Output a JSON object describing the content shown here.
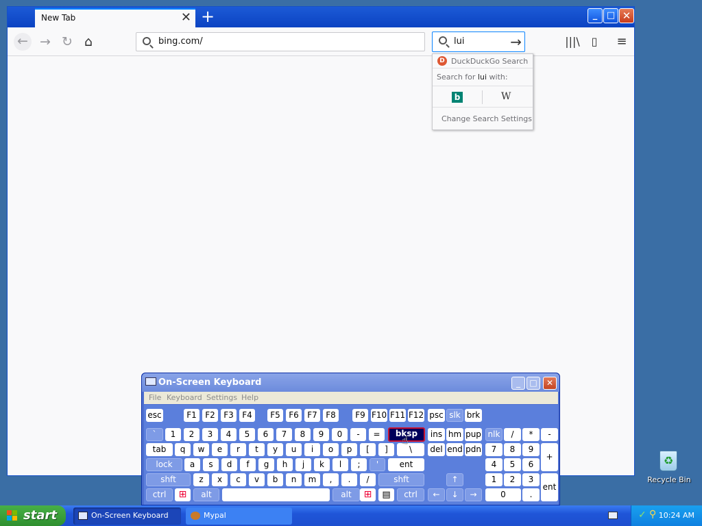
{
  "browser": {
    "tab_title": "New Tab",
    "tab_close": "✕",
    "new_tab": "+",
    "url": "bing.com/",
    "search_query": "lui",
    "search_go": "→",
    "nav": {
      "back": "←",
      "forward": "→",
      "reload": "↻",
      "home": "⌂",
      "library": "|||\\",
      "sidebar": "▯",
      "menu": "≡"
    },
    "window_controls": {
      "minimize": "_",
      "maximize": "□",
      "close": "✕"
    }
  },
  "search_popup": {
    "engine_name": "DuckDuckGo Search",
    "search_for_prefix": "Search for ",
    "search_for_query": "lui",
    "search_for_suffix": " with:",
    "engine_bing": "b",
    "engine_wiki": "W",
    "change_settings": "Change Search Settings"
  },
  "desktop": {
    "recycle_bin": "Recycle Bin"
  },
  "osk": {
    "title": "On-Screen Keyboard",
    "controls": {
      "minimize": "_",
      "maximize": "□",
      "close": "✕"
    },
    "menus": [
      "File",
      "Keyboard",
      "Settings",
      "Help"
    ],
    "keys": {
      "esc": "esc",
      "fn": [
        "F1",
        "F2",
        "F3",
        "F4",
        "F5",
        "F6",
        "F7",
        "F8",
        "F9",
        "F10",
        "F11",
        "F12"
      ],
      "psc": "psc",
      "slk": "slk",
      "brk": "brk",
      "num_row": [
        "`",
        "1",
        "2",
        "3",
        "4",
        "5",
        "6",
        "7",
        "8",
        "9",
        "0",
        "-",
        "="
      ],
      "bksp": "bksp",
      "ins": "ins",
      "hm": "hm",
      "pup": "pup",
      "nlk": "nlk",
      "np_div": "/",
      "np_mul": "*",
      "np_sub": "-",
      "tab": "tab",
      "q_row": [
        "q",
        "w",
        "e",
        "r",
        "t",
        "y",
        "u",
        "i",
        "o",
        "p",
        "[",
        "]",
        "\\"
      ],
      "del": "del",
      "end": "end",
      "pdn": "pdn",
      "np7": "7",
      "np8": "8",
      "np9": "9",
      "np_add": "+",
      "lock": "lock",
      "a_row": [
        "a",
        "s",
        "d",
        "f",
        "g",
        "h",
        "j",
        "k",
        "l",
        ";",
        "'"
      ],
      "ent": "ent",
      "np4": "4",
      "np5": "5",
      "np6": "6",
      "shft": "shft",
      "z_row": [
        "z",
        "x",
        "c",
        "v",
        "b",
        "n",
        "m",
        ",",
        ".",
        "/"
      ],
      "up": "↑",
      "np1": "1",
      "np2": "2",
      "np3": "3",
      "np_ent": "ent",
      "ctrl": "ctrl",
      "alt": "alt",
      "left": "←",
      "down": "↓",
      "right": "→",
      "np0": "0",
      "np_dot": "."
    }
  },
  "taskbar": {
    "start": "start",
    "items": [
      "On-Screen Keyboard",
      "Mypal"
    ],
    "clock": "10:24 AM"
  }
}
